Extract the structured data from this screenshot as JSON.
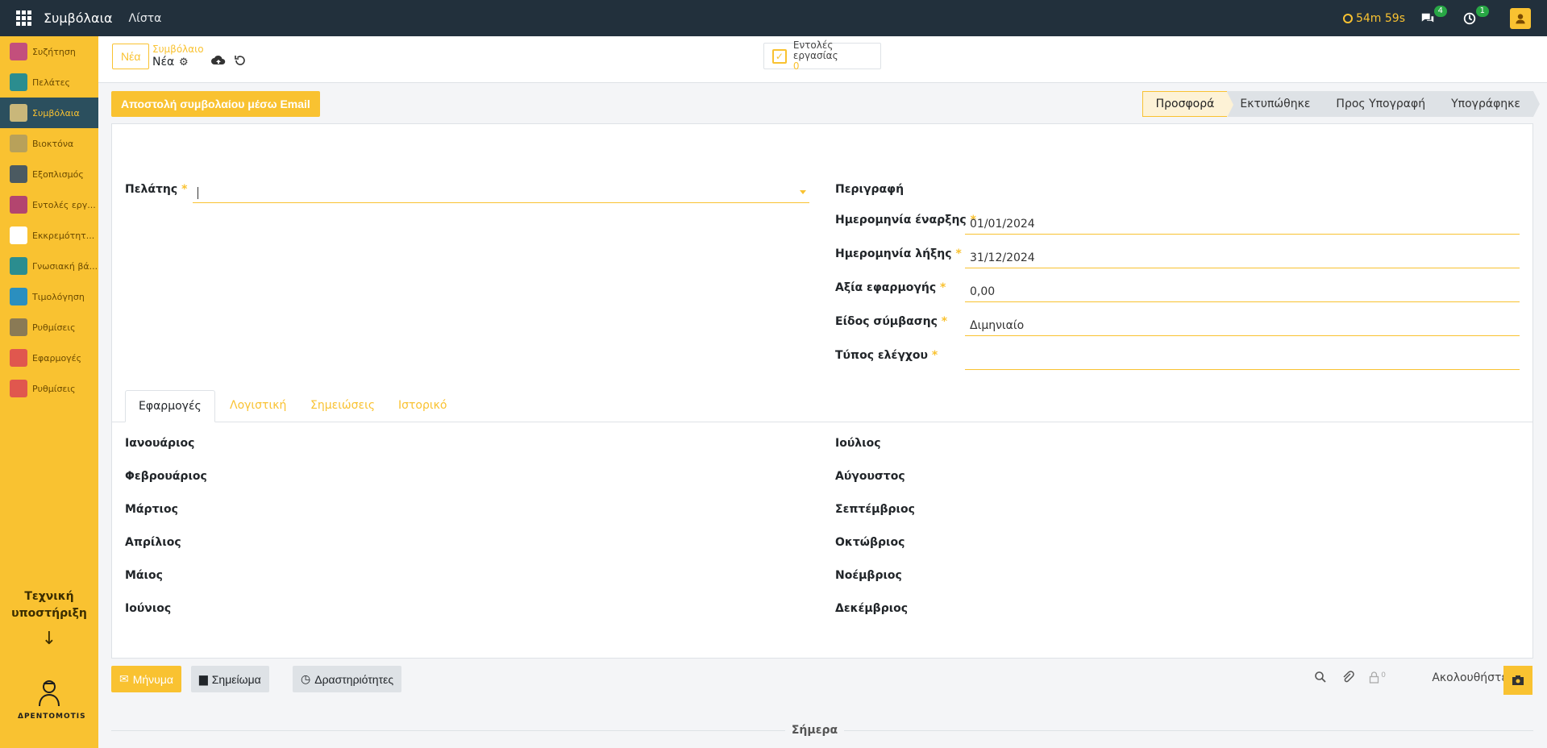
{
  "topbar": {
    "app_title": "Συμβόλαια",
    "menu_list": "Λίστα",
    "timer": "54m 59s",
    "messages_count": "4",
    "activities_count": "1"
  },
  "sidebar": {
    "items": [
      {
        "label": "Συζήτηση",
        "icon": "chat-icon",
        "color": "#c34f7c"
      },
      {
        "label": "Πελάτες",
        "icon": "contacts-icon",
        "color": "#2b8d8f"
      },
      {
        "label": "Συμβόλαια",
        "icon": "contract-icon",
        "color": "#c9b77a"
      },
      {
        "label": "Βιοκτόνα",
        "icon": "biocide-icon",
        "color": "#b8a15a"
      },
      {
        "label": "Εξοπλισμός",
        "icon": "equipment-icon",
        "color": "#4b5a61"
      },
      {
        "label": "Εντολές εργ...",
        "icon": "workorder-icon",
        "color": "#b3456f"
      },
      {
        "label": "Εκκρεμότητ...",
        "icon": "pending-icon",
        "color": "#ffffff"
      },
      {
        "label": "Γνωσιακή βά...",
        "icon": "knowledge-icon",
        "color": "#2b8d8f"
      },
      {
        "label": "Τιμολόγηση",
        "icon": "invoice-icon",
        "color": "#2b8fbf"
      },
      {
        "label": "Ρυθμίσεις",
        "icon": "settings-icon",
        "color": "#8a7a55"
      },
      {
        "label": "Εφαρμογές",
        "icon": "apps-icon",
        "color": "#e0574e"
      },
      {
        "label": "Ρυθμίσεις",
        "icon": "settings2-icon",
        "color": "#e0574e"
      }
    ],
    "support": "Τεχνική υποστήριξη",
    "logo_text": "ΔΡΕΝΤΟΜΟΤΙS"
  },
  "control": {
    "new_button": "Νέα",
    "breadcrumb_parent": "Συμβόλαιο",
    "breadcrumb_current": "Νέα",
    "work_orders_label": "Εντολές εργασίας",
    "work_orders_count": "0"
  },
  "statusbar": {
    "email_button": "Αποστολή συμβολαίου μέσω Email",
    "stages": [
      "Προσφορά",
      "Εκτυπώθηκε",
      "Προς Υπογραφή",
      "Υπογράφηκε"
    ]
  },
  "form": {
    "customer_label": "Πελάτης",
    "customer_value": "",
    "description_label": "Περιγραφή",
    "start_date_label": "Ημερομηνία έναρξης",
    "start_date_value": "01/01/2024",
    "end_date_label": "Ημερομηνία λήξης",
    "end_date_value": "31/12/2024",
    "application_value_label": "Αξία εφαρμογής",
    "application_value": "0,00",
    "contract_type_label": "Είδος σύμβασης",
    "contract_type_value": "Διμηνιαίο",
    "control_type_label": "Τύπος ελέγχου",
    "control_type_value": "",
    "required_mark": "*"
  },
  "tabs": [
    "Εφαρμογές",
    "Λογιστική",
    "Σημειώσεις",
    "Ιστορικό"
  ],
  "months_left": [
    "Ιανουάριος",
    "Φεβρουάριος",
    "Μάρτιος",
    "Απρίλιος",
    "Μάιος",
    "Ιούνιος"
  ],
  "months_right": [
    "Ιούλιος",
    "Αύγουστος",
    "Σεπτέμβριος",
    "Οκτώβριος",
    "Νοέμβριος",
    "Δεκέμβριος"
  ],
  "chatter": {
    "message_button": "Μήνυμα",
    "note_button": "Σημείωμα",
    "activities_button": "Δραστηριότητες",
    "followers_count": "0",
    "follow_label": "Ακολουθήστε",
    "today": "Σήμερα"
  },
  "colors": {
    "accent": "#f9c231",
    "navbar": "#22303c",
    "sidebar_active": "#2b4f5e"
  }
}
